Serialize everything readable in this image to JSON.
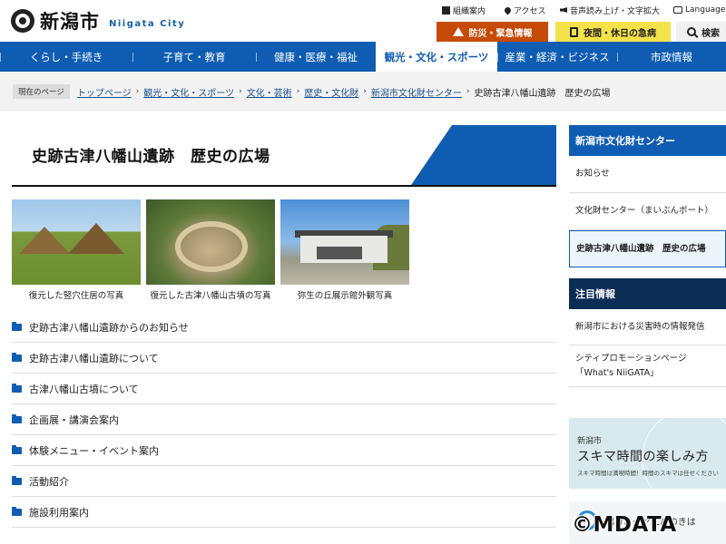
{
  "header": {
    "logo_jp": "新潟市",
    "logo_en": "Niigata City",
    "util_links": [
      "組織案内",
      "アクセス",
      "音声読み上げ・文字拡大",
      "Language"
    ],
    "disaster_label": "防災・緊急情報",
    "clinic_label": "夜間・休日の急病",
    "search_label": "検索"
  },
  "nav": {
    "items": [
      "くらし・手続き",
      "子育て・教育",
      "健康・医療・福祉",
      "観光・文化・スポーツ",
      "産業・経済・ビジネス",
      "市政情報"
    ],
    "active": "観光・文化・スポーツ"
  },
  "breadcrumb": {
    "label": "現在のページ",
    "links": [
      "トップページ",
      "観光・文化・スポーツ",
      "文化・芸術",
      "歴史・文化財",
      "新潟市文化財センター"
    ],
    "current": "史跡古津八幡山遺跡　歴史の広場"
  },
  "main": {
    "title": "史跡古津八幡山遺跡　歴史の広場",
    "photos": [
      {
        "caption": "復元した竪穴住居の写真"
      },
      {
        "caption": "復元した古津八幡山古墳の写真"
      },
      {
        "caption": "弥生の丘展示館外観写真"
      }
    ],
    "links": [
      "史跡古津八幡山遺跡からのお知らせ",
      "史跡古津八幡山遺跡について",
      "古津八幡山古墳について",
      "企画展・講演会案内",
      "体験メニュー・イベント案内",
      "活動紹介",
      "施設利用案内"
    ]
  },
  "sidebar": {
    "section_title": "新潟市文化財センター",
    "items": [
      "お知らせ",
      "文化財センター（まいぶんポート）",
      "史跡古津八幡山遺跡　歴史の広場"
    ],
    "notice_title": "注目情報",
    "notice_items": [
      "新潟市における災害時の情報発信",
      "シティプロモーションページ「What's NiiGATA」"
    ],
    "banner": {
      "line1": "新潟市",
      "line2": "スキマ時間の楽しみ方",
      "line3": "スキマ時間は満喫時間！時間のスキマは任せください"
    },
    "banner2_text": "潟ガニーヤ二バのきは"
  },
  "watermark": "©MDATA",
  "colors": {
    "brand_blue": "#0f5db3",
    "disaster_orange": "#c64a08",
    "clinic_yellow": "#f4e24a",
    "notice_navy": "#0b2c55"
  }
}
